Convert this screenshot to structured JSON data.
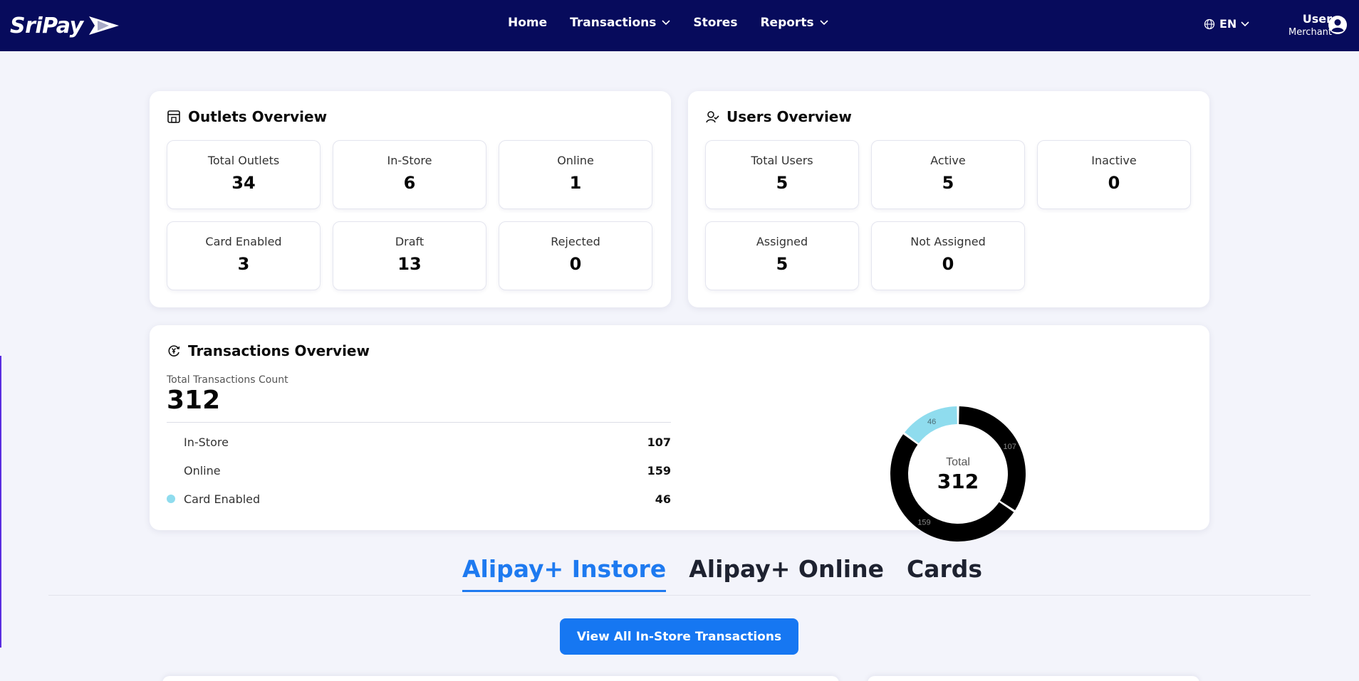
{
  "brand": {
    "name": "SriPay"
  },
  "nav": {
    "items": [
      {
        "label": "Home",
        "has_dropdown": false
      },
      {
        "label": "Transactions",
        "has_dropdown": true
      },
      {
        "label": "Stores",
        "has_dropdown": false
      },
      {
        "label": "Reports",
        "has_dropdown": true
      }
    ],
    "language": "EN",
    "user_name": "User",
    "user_role": "Merchant"
  },
  "outlets": {
    "title": "Outlets Overview",
    "stats": [
      {
        "label": "Total Outlets",
        "value": "34"
      },
      {
        "label": "In-Store",
        "value": "6"
      },
      {
        "label": "Online",
        "value": "1"
      },
      {
        "label": "Card Enabled",
        "value": "3"
      },
      {
        "label": "Draft",
        "value": "13"
      },
      {
        "label": "Rejected",
        "value": "0"
      }
    ]
  },
  "users": {
    "title": "Users Overview",
    "stats": [
      {
        "label": "Total Users",
        "value": "5"
      },
      {
        "label": "Active",
        "value": "5"
      },
      {
        "label": "Inactive",
        "value": "0"
      },
      {
        "label": "Assigned",
        "value": "5"
      },
      {
        "label": "Not Assigned",
        "value": "0"
      }
    ]
  },
  "transactions": {
    "title": "Transactions Overview",
    "total_label": "Total Transactions Count",
    "total_value": "312",
    "rows": [
      {
        "label": "In-Store",
        "value": "107",
        "color": "#000000"
      },
      {
        "label": "Online",
        "value": "159",
        "color": "#000000"
      },
      {
        "label": "Card Enabled",
        "value": "46",
        "color": "#8fdcee"
      }
    ],
    "donut": {
      "center_label": "Total",
      "center_value": "312",
      "segments": [
        {
          "label": "107",
          "value": 107,
          "color": "#000000"
        },
        {
          "label": "159",
          "value": 159,
          "color": "#000000"
        },
        {
          "label": "46",
          "value": 46,
          "color": "#8fdcee"
        }
      ]
    }
  },
  "tabs": {
    "items": [
      {
        "label": "Alipay+ Instore",
        "active": true
      },
      {
        "label": "Alipay+ Online",
        "active": false
      },
      {
        "label": "Cards",
        "active": false
      }
    ]
  },
  "cta": {
    "label": "View All In-Store Transactions"
  },
  "colors": {
    "navbar": "#070b5c",
    "accent": "#1677f2",
    "card_enabled": "#8fdcee"
  }
}
